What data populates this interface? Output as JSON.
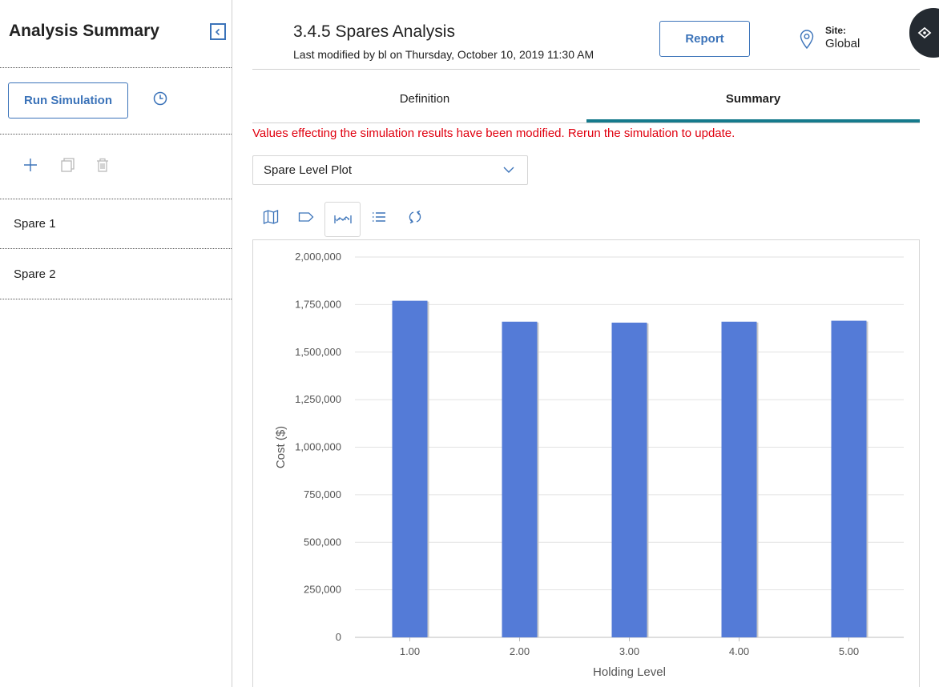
{
  "sidebar": {
    "title": "Analysis Summary",
    "run_label": "Run Simulation",
    "items": [
      {
        "label": "Spare 1"
      },
      {
        "label": "Spare 2"
      }
    ],
    "icons": [
      "collapse-icon",
      "history-icon",
      "add-icon",
      "copy-icon",
      "delete-icon"
    ]
  },
  "header": {
    "title": "3.4.5 Spares Analysis",
    "subtitle": "Last modified by bl on Thursday, October 10, 2019 11:30 AM",
    "report_label": "Report",
    "site_label": "Site:",
    "site_value": "Global"
  },
  "tabs": [
    {
      "label": "Definition",
      "active": false
    },
    {
      "label": "Summary",
      "active": true
    }
  ],
  "warning": "Values effecting the simulation results have been modified. Rerun the simulation to update.",
  "plot_select": {
    "selected": "Spare Level Plot"
  },
  "chart_toolbar": [
    "map-icon",
    "tag-icon",
    "line-range-icon",
    "list-icon",
    "refresh-icon"
  ],
  "colors": {
    "accent": "#3b73b9",
    "tab_underline": "#157a8c",
    "warning": "#e0000f",
    "bar": "#547bd7"
  },
  "chart_data": {
    "type": "bar",
    "categories": [
      "1.00",
      "2.00",
      "3.00",
      "4.00",
      "5.00"
    ],
    "values": [
      1770000,
      1660000,
      1655000,
      1660000,
      1665000
    ],
    "xlabel": "Holding Level",
    "ylabel": "Cost ($)",
    "ylim": [
      0,
      2000000
    ],
    "yticks": [
      "0",
      "250,000",
      "500,000",
      "750,000",
      "1,000,000",
      "1,250,000",
      "1,500,000",
      "1,750,000",
      "2,000,000"
    ],
    "grid": true
  }
}
